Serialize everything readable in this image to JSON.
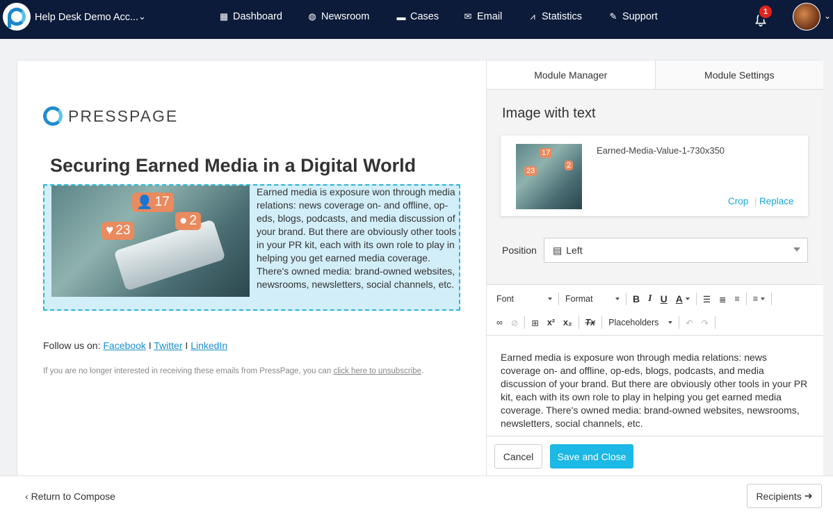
{
  "header": {
    "account": "Help Desk Demo Acc...",
    "nav": [
      {
        "label": "Dashboard",
        "icon": "dashboard-icon"
      },
      {
        "label": "Newsroom",
        "icon": "globe-icon"
      },
      {
        "label": "Cases",
        "icon": "folder-icon"
      },
      {
        "label": "Email",
        "icon": "envelope-icon"
      },
      {
        "label": "Statistics",
        "icon": "chart-icon"
      },
      {
        "label": "Support",
        "icon": "ticket-icon"
      }
    ],
    "notifications": "1"
  },
  "preview": {
    "brand": "PRESSPAGE",
    "headline": "Securing Earned Media in a Digital World",
    "image_badges": {
      "users": "17",
      "likes": "23",
      "comments": "2"
    },
    "body": "Earned media is exposure won through media relations: news coverage on- and offline, op-eds, blogs, podcasts, and media discussion of your brand. But there are obviously other tools in your PR kit, each with its own role to play in helping you get earned media coverage. There's owned media: brand-owned websites, newsrooms, newsletters, social channels, etc.",
    "follow_prefix": "Follow us on:",
    "social": [
      "Facebook",
      "Twitter",
      "LinkedIn"
    ],
    "social_sep": "I",
    "unsub_text": "If you are no longer interested in receiving these emails from PressPage, you can",
    "unsub_link": "click here to unsubscribe",
    "unsub_end": "."
  },
  "sidebar": {
    "tabs": [
      "Module Manager",
      "Module Settings"
    ],
    "title": "Image with text",
    "image_name": "Earned-Media-Value-1-730x350",
    "thumb_badges": {
      "users": "17",
      "likes": "23",
      "comments": "2"
    },
    "crop": "Crop",
    "replace": "Replace",
    "position_label": "Position",
    "position_value": "Left",
    "toolbar": {
      "font": "Font",
      "format": "Format",
      "bold": "B",
      "italic": "I",
      "underline": "U",
      "color": "A",
      "sup": "x²",
      "sub": "x₂",
      "clear": "Tx",
      "placeholders": "Placeholders"
    },
    "text": "Earned media is exposure won through media relations: news coverage on- and offline, op-eds, blogs, podcasts, and media discussion of your brand. But there are obviously other tools in your PR kit, each with its own role to play in helping you get earned media coverage. There's owned media: brand-owned websites, newsrooms, newsletters, social channels, etc.",
    "cancel": "Cancel",
    "save": "Save and Close"
  },
  "footer": {
    "return": "Return to Compose",
    "recipients": "Recipients"
  },
  "colors": {
    "navbar": "#0c1b3a",
    "accent": "#1cb8e6",
    "link": "#1aa7d8",
    "badge": "#e2231a"
  }
}
